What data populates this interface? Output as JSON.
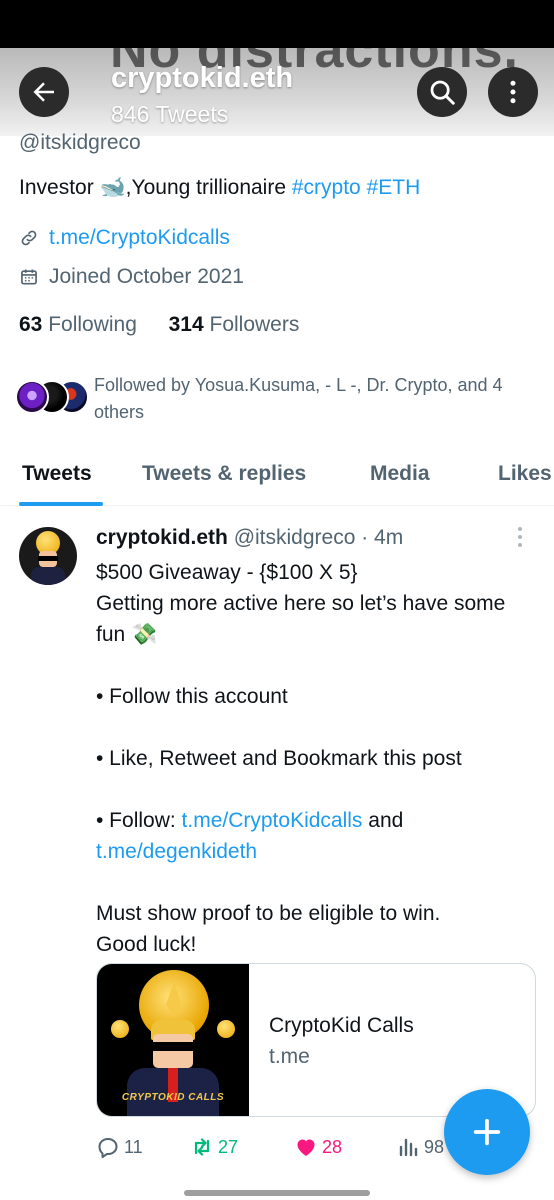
{
  "header": {
    "banner_text": "No distractions.",
    "display_name": "cryptokid.eth",
    "tweet_count": "846 Tweets"
  },
  "profile": {
    "handle": "@itskidgreco",
    "bio": {
      "prefix": "Investor 🐋,Young trillionaire ",
      "hashtag1": "#crypto",
      "hashtag2": "#ETH"
    },
    "link": "t.me/CryptoKidcalls",
    "joined": "Joined October 2021",
    "following_count": "63",
    "following_label": "Following",
    "followers_count": "314",
    "followers_label": "Followers",
    "followed_by": "Followed by Yosua.Kusuma, - L -, Dr. Crypto, and 4 others"
  },
  "tabs": [
    {
      "label": "Tweets"
    },
    {
      "label": "Tweets & replies"
    },
    {
      "label": "Media"
    },
    {
      "label": "Likes"
    }
  ],
  "tweet": {
    "name": "cryptokid.eth",
    "handle_time": "@itskidgreco · 4m",
    "lines": [
      "$500 Giveaway - {$100 X 5}",
      "Getting more active here so let’s have some fun 💸",
      "",
      "• Follow this account",
      "",
      "• Like, Retweet and Bookmark this post",
      "",
      "Must show proof to be eligible to win.",
      "Good luck!"
    ],
    "follow_line": {
      "prefix": "• Follow:  ",
      "link1": "t.me/CryptoKidcalls",
      "middle": " and ",
      "link2": "t.me/degenkideth"
    },
    "card": {
      "image_label": "CRYPTOKID CALLS",
      "title": "CryptoKid Calls",
      "domain": "t.me"
    },
    "actions": {
      "replies": "11",
      "retweets": "27",
      "likes": "28",
      "views": "98"
    }
  },
  "colors": {
    "accent": "#1d9bf0",
    "retweet": "#00ba7c",
    "like": "#f91880",
    "secondary_text": "#536471"
  },
  "icons": [
    "back-arrow-icon",
    "search-icon",
    "more-vertical-icon",
    "link-icon",
    "calendar-icon",
    "reply-icon",
    "retweet-icon",
    "heart-icon",
    "views-icon",
    "plus-icon"
  ]
}
